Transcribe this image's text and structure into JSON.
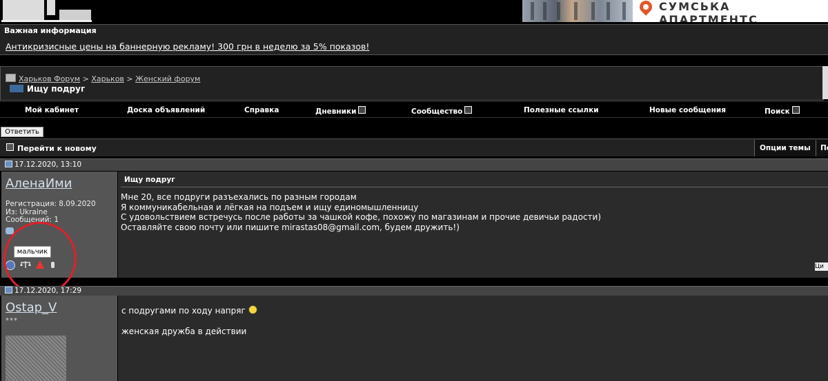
{
  "banner": {
    "ad_title": "СУМСЬКА АПАРТМЕНТС"
  },
  "info": {
    "title": "Важная информация",
    "link": "Антикризисные цены на баннерную рекламу! 300 грн в неделю за 5% показов!"
  },
  "breadcrumb": {
    "items": [
      "Харьков Форум",
      "Харьков",
      "Женский форум"
    ],
    "separator": ">",
    "thread_title": "Ищу подруг"
  },
  "menu": {
    "items": [
      "Мой кабинет",
      "Доска объявлений",
      "Справка",
      "Дневники",
      "Сообщество",
      "Полезные ссылки",
      "Новые сообщения",
      "Поиск"
    ]
  },
  "toolbar": {
    "reply": "Ответить",
    "goto_new": "Перейти к новому",
    "thread_options": "Опции темы",
    "next_cell": "По"
  },
  "post1": {
    "date": "17.12.2020, 13:10",
    "username": "АленаИми",
    "registration": "Регистрация: 8.09.2020",
    "from": "Из: Ukraine",
    "messages": "Сообщений: 1",
    "tooltip": "мальчик",
    "subject": "Ищу подруг",
    "body": "Мне 20, все подруги разъехались по разным городам\nЯ коммуникабельная и лёгкая на подъем и ищу единомышленницу\nС удовольствием встречусь после работы за чашкой кофе, похожу по магазинам и прочие девичьи радости)\nОставляйте свою почту или пишите mirastas08@gmail.com, будем дружить!)",
    "quote_btn": "Ци"
  },
  "post2": {
    "date": "17.12.2020, 17:29",
    "username": "Ostap_V",
    "stars": "***",
    "line1": "с подругами по ходу напряг",
    "line2": "женская дружба в действии"
  },
  "colors": {
    "highlight_circle": "#e0202a"
  }
}
